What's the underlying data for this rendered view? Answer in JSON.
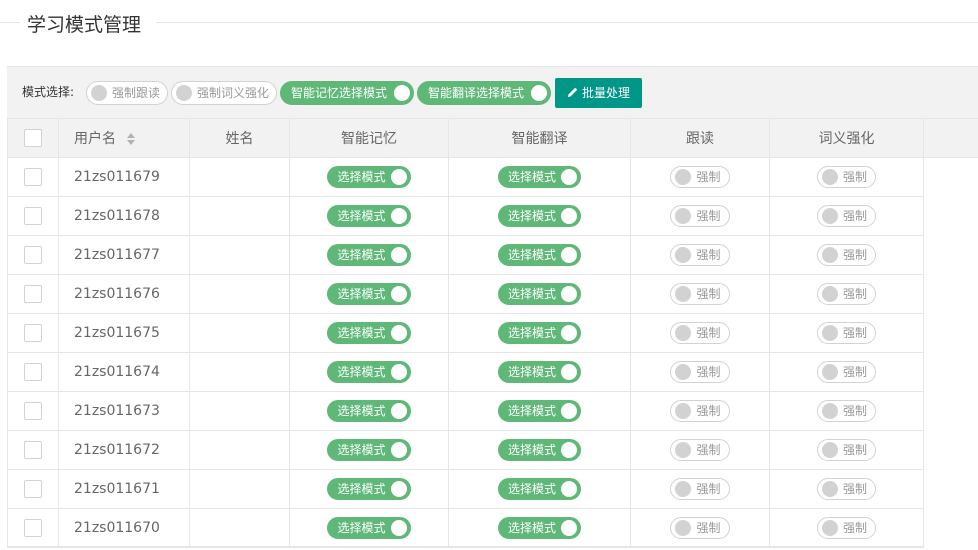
{
  "page": {
    "title": "学习模式管理"
  },
  "toolbar": {
    "mode_label": "模式选择:",
    "switches": [
      {
        "label": "强制跟读",
        "state": "off"
      },
      {
        "label": "强制词义强化",
        "state": "off"
      },
      {
        "label": "智能记忆选择模式",
        "state": "on"
      },
      {
        "label": "智能翻译选择模式",
        "state": "on"
      }
    ],
    "batch_label": "批量处理",
    "batch_icon": "pencil-icon"
  },
  "table": {
    "columns": [
      "用户名",
      "姓名",
      "智能记忆",
      "智能翻译",
      "跟读",
      "词义强化"
    ],
    "rows": [
      {
        "username": "21zs011679",
        "name": "",
        "memory": "选择模式",
        "translate": "选择模式",
        "follow": "强制",
        "meaning": "强制"
      },
      {
        "username": "21zs011678",
        "name": "",
        "memory": "选择模式",
        "translate": "选择模式",
        "follow": "强制",
        "meaning": "强制"
      },
      {
        "username": "21zs011677",
        "name": "",
        "memory": "选择模式",
        "translate": "选择模式",
        "follow": "强制",
        "meaning": "强制"
      },
      {
        "username": "21zs011676",
        "name": "",
        "memory": "选择模式",
        "translate": "选择模式",
        "follow": "强制",
        "meaning": "强制"
      },
      {
        "username": "21zs011675",
        "name": "",
        "memory": "选择模式",
        "translate": "选择模式",
        "follow": "强制",
        "meaning": "强制"
      },
      {
        "username": "21zs011674",
        "name": "",
        "memory": "选择模式",
        "translate": "选择模式",
        "follow": "强制",
        "meaning": "强制"
      },
      {
        "username": "21zs011673",
        "name": "",
        "memory": "选择模式",
        "translate": "选择模式",
        "follow": "强制",
        "meaning": "强制"
      },
      {
        "username": "21zs011672",
        "name": "",
        "memory": "选择模式",
        "translate": "选择模式",
        "follow": "强制",
        "meaning": "强制"
      },
      {
        "username": "21zs011671",
        "name": "",
        "memory": "选择模式",
        "translate": "选择模式",
        "follow": "强制",
        "meaning": "强制"
      },
      {
        "username": "21zs011670",
        "name": "",
        "memory": "选择模式",
        "translate": "选择模式",
        "follow": "强制",
        "meaning": "强制"
      }
    ]
  },
  "colors": {
    "switch_on": "#5fb878",
    "switch_off": "#d2d2d2",
    "batch_button": "#009688",
    "header_bg": "#f2f2f2",
    "border": "#e6e6e6"
  }
}
